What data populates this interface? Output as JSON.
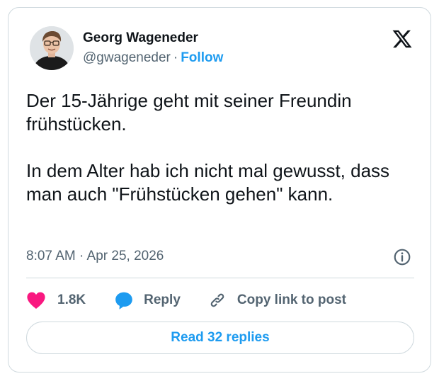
{
  "author": {
    "name": "Georg Wageneder",
    "handle": "@gwageneder",
    "separator": "·",
    "follow_label": "Follow"
  },
  "tweet": {
    "text": "Der 15-Jährige geht mit seiner Freundin frühstücken.\n\nIn dem Alter hab ich nicht mal gewusst, dass man auch \"Frühstücken gehen\" kann.",
    "timestamp": "8:07 AM · Apr 25, 2026"
  },
  "actions": {
    "like_count": "1.8K",
    "reply_label": "Reply",
    "copy_label": "Copy link to post"
  },
  "read_replies_label": "Read 32 replies",
  "colors": {
    "accent": "#1d9bf0",
    "like": "#f91880",
    "text": "#0f1419",
    "muted": "#536471",
    "border": "#cfd9de"
  },
  "icons": {
    "platform": "x-logo-icon",
    "like": "heart-icon",
    "reply": "speech-bubble-icon",
    "copy": "link-icon",
    "info": "info-icon"
  }
}
